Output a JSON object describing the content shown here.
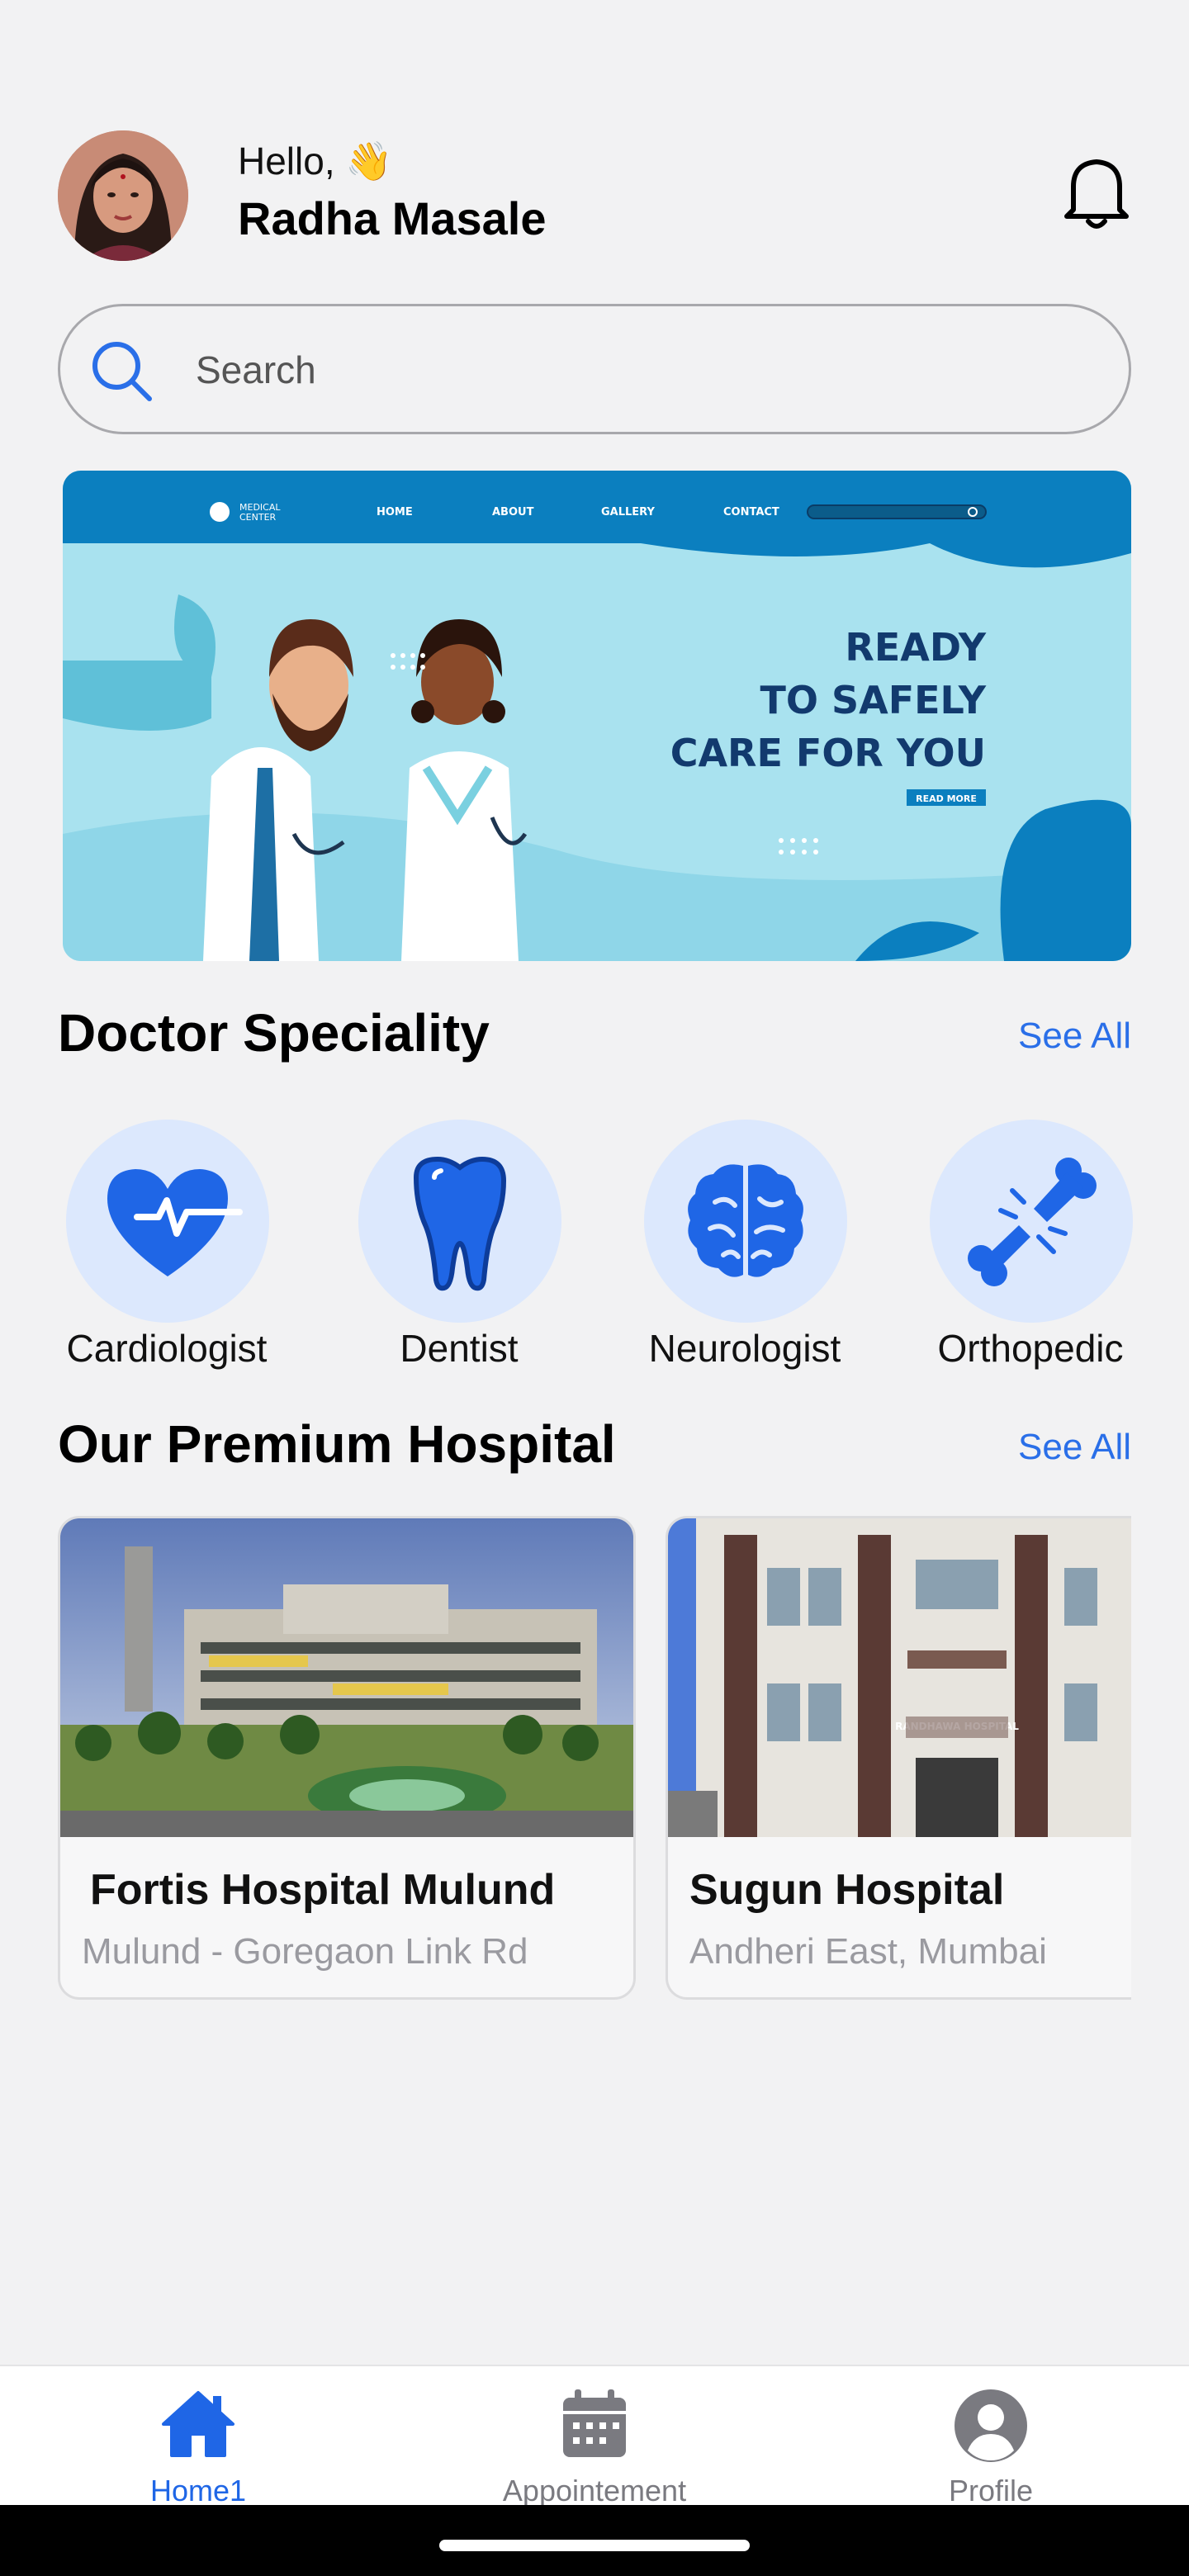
{
  "header": {
    "greeting": "Hello, 👋",
    "user_name": "Radha Masale"
  },
  "search": {
    "placeholder": "Search"
  },
  "banner": {
    "brand": "MEDICAL CENTER",
    "nav": [
      "HOME",
      "ABOUT",
      "GALLERY",
      "CONTACT"
    ],
    "headline": [
      "READY",
      "TO SAFELY",
      "CARE FOR YOU"
    ],
    "cta": "READ MORE"
  },
  "specialities": {
    "title": "Doctor Speciality",
    "see_all": "See All",
    "items": [
      {
        "label": "Cardiologist",
        "icon": "heart-pulse-icon"
      },
      {
        "label": "Dentist",
        "icon": "tooth-icon"
      },
      {
        "label": "Neurologist",
        "icon": "brain-icon"
      },
      {
        "label": "Orthopedic",
        "icon": "broken-bone-icon"
      }
    ]
  },
  "hospitals": {
    "title": "Our Premium Hospital",
    "see_all": "See All",
    "items": [
      {
        "name": "Fortis Hospital Mulund",
        "address": "Mulund - Goregaon Link Rd"
      },
      {
        "name": "Sugun Hospital",
        "address": "Andheri East, Mumbai",
        "sign": "RANDHAWA HOSPITAL"
      }
    ]
  },
  "bottom_nav": {
    "items": [
      {
        "label": "Home1",
        "icon": "home-icon",
        "active": true
      },
      {
        "label": "Appointement",
        "icon": "calendar-icon",
        "active": false
      },
      {
        "label": "Profile",
        "icon": "profile-icon",
        "active": false
      }
    ]
  },
  "colors": {
    "accent": "#2a6fe8",
    "icon_blue": "#1f66e6",
    "icon_bg": "#dce8fd",
    "nav_inactive": "#7a7a80",
    "banner_bg": "#a9e2ef",
    "banner_bar": "#0b7fbf"
  }
}
